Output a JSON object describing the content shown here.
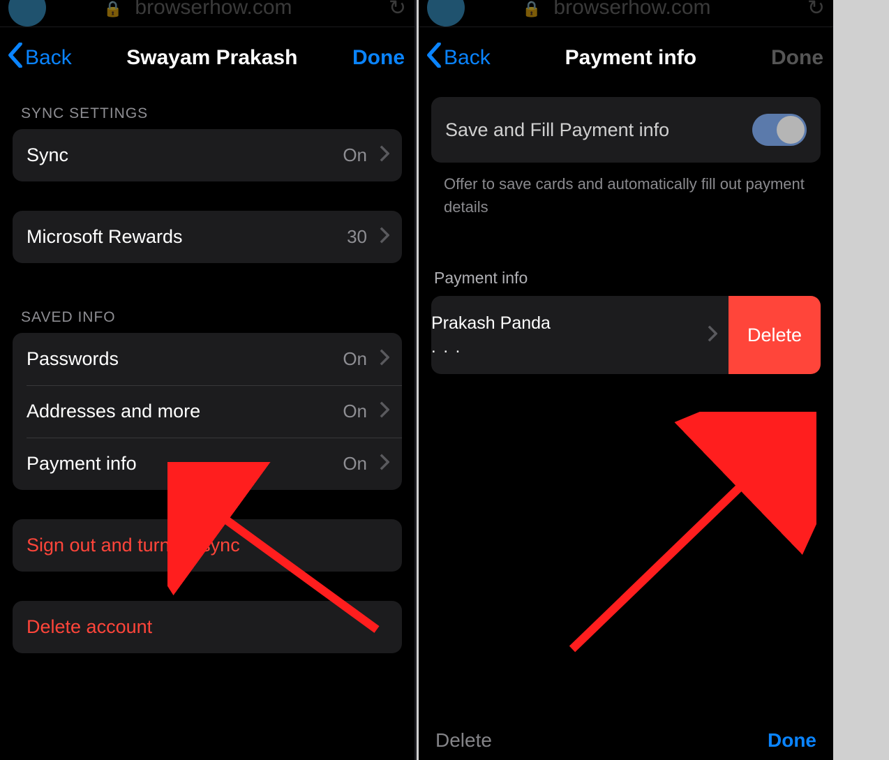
{
  "browser": {
    "url": "browserhow.com"
  },
  "left": {
    "nav": {
      "back": "Back",
      "title": "Swayam Prakash",
      "done": "Done"
    },
    "sections": {
      "sync_header": "SYNC SETTINGS",
      "sync_row": {
        "label": "Sync",
        "value": "On"
      },
      "rewards_row": {
        "label": "Microsoft Rewards",
        "value": "30"
      },
      "saved_header": "SAVED INFO",
      "passwords_row": {
        "label": "Passwords",
        "value": "On"
      },
      "addresses_row": {
        "label": "Addresses and more",
        "value": "On"
      },
      "payment_row": {
        "label": "Payment info",
        "value": "On"
      },
      "signout": "Sign out and turn off sync",
      "delete_account": "Delete account"
    }
  },
  "right": {
    "nav": {
      "back": "Back",
      "title": "Payment info",
      "done": "Done"
    },
    "toggle": {
      "label": "Save and Fill Payment info",
      "description": "Offer to save cards and automatically fill out payment details"
    },
    "section_header": "Payment info",
    "card": {
      "name": "Prakash Panda",
      "masked": ". . ."
    },
    "delete_swipe": "Delete",
    "toolbar": {
      "delete": "Delete",
      "done": "Done"
    }
  }
}
